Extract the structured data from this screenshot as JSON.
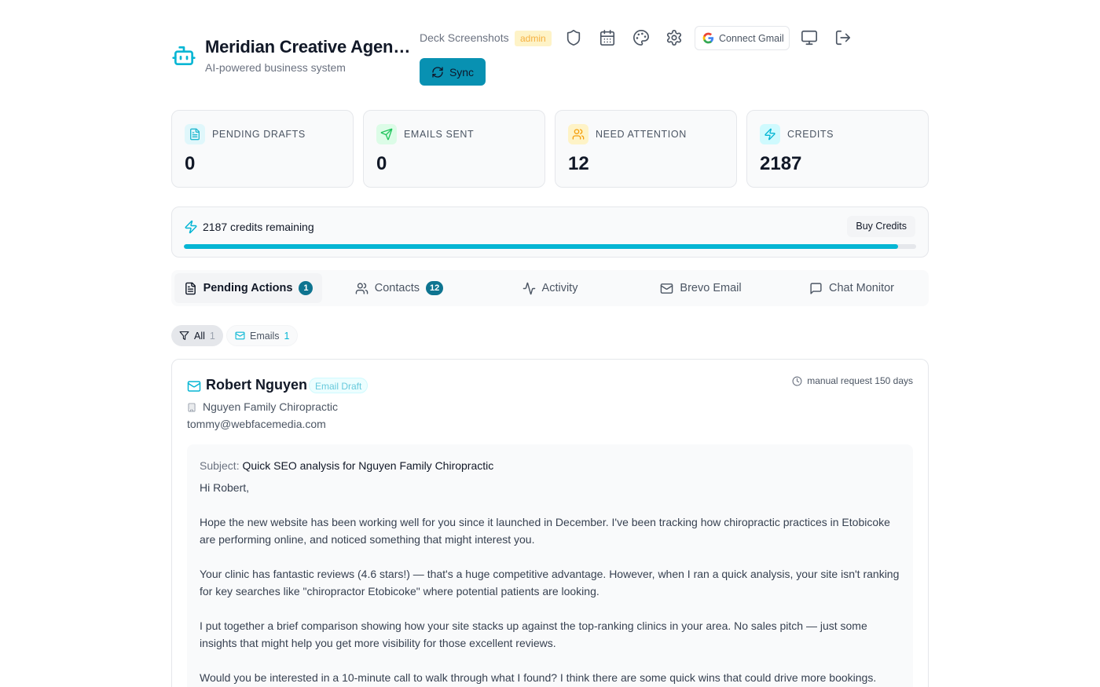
{
  "brand": {
    "title": "Meridian Creative Agency",
    "subtitle": "AI-powered business system"
  },
  "header": {
    "workspace": "Deck Screenshots",
    "role_badge": "admin",
    "icons": [
      "shield-icon",
      "calendar-icon",
      "palette-icon",
      "gear-icon",
      "monitor-icon",
      "logout-icon"
    ],
    "connect_gmail_label": "Connect Gmail",
    "sync_label": "Sync"
  },
  "stats": [
    {
      "label": "PENDING DRAFTS",
      "value": "0",
      "icon": "document-icon",
      "color": "#22b8cf"
    },
    {
      "label": "EMAILS SENT",
      "value": "0",
      "icon": "send-icon",
      "color": "#22c55e"
    },
    {
      "label": "NEED ATTENTION",
      "value": "12",
      "icon": "users-icon",
      "color": "#f59e0b"
    },
    {
      "label": "CREDITS",
      "value": "2187",
      "icon": "bolt-icon",
      "color": "#06b6d4"
    }
  ],
  "credits": {
    "text": "2187 credits remaining",
    "buy_label": "Buy Credits",
    "progress_fraction": 0.975
  },
  "tabs": [
    {
      "label": "Pending Actions",
      "count": "1",
      "icon": "document-icon",
      "active": true
    },
    {
      "label": "Contacts",
      "count": "12",
      "icon": "users-icon",
      "active": false
    },
    {
      "label": "Activity",
      "count": null,
      "icon": "activity-icon",
      "active": false
    },
    {
      "label": "Brevo Email",
      "count": null,
      "icon": "mail-icon",
      "active": false
    },
    {
      "label": "Chat Monitor",
      "count": null,
      "icon": "chat-icon",
      "active": false
    }
  ],
  "filters": [
    {
      "label": "All",
      "count": "1"
    },
    {
      "label": "Emails",
      "count": "1"
    }
  ],
  "draft": {
    "name": "Robert Nguyen",
    "type": "Email Draft",
    "time": "manual request 150 days",
    "company": "Nguyen Family Chiropractic",
    "email": "tommy@webfacemedia.com",
    "subject_label": "Subject:",
    "subject": "Quick SEO analysis for Nguyen Family Chiropractic",
    "greeting": "Hi Robert,",
    "paragraphs": [
      "Hope the new website has been working well for you since it launched in December. I've been tracking how chiropractic practices in Etobicoke are performing online, and noticed something that might interest you.",
      "Your clinic has fantastic reviews (4.6 stars!) — that's a huge competitive advantage. However, when I ran a quick analysis, your site isn't ranking for key searches like \"chiropractor Etobicoke\" where potential patients are looking.",
      "I put together a brief comparison showing how your site stacks up against the top-ranking clinics in your area. No sales pitch — just some insights that might help you get more visibility for those excellent reviews.",
      "Would you be interested in a 10-minute call to walk through what I found? I think there are some quick wins that could drive more bookings."
    ]
  }
}
